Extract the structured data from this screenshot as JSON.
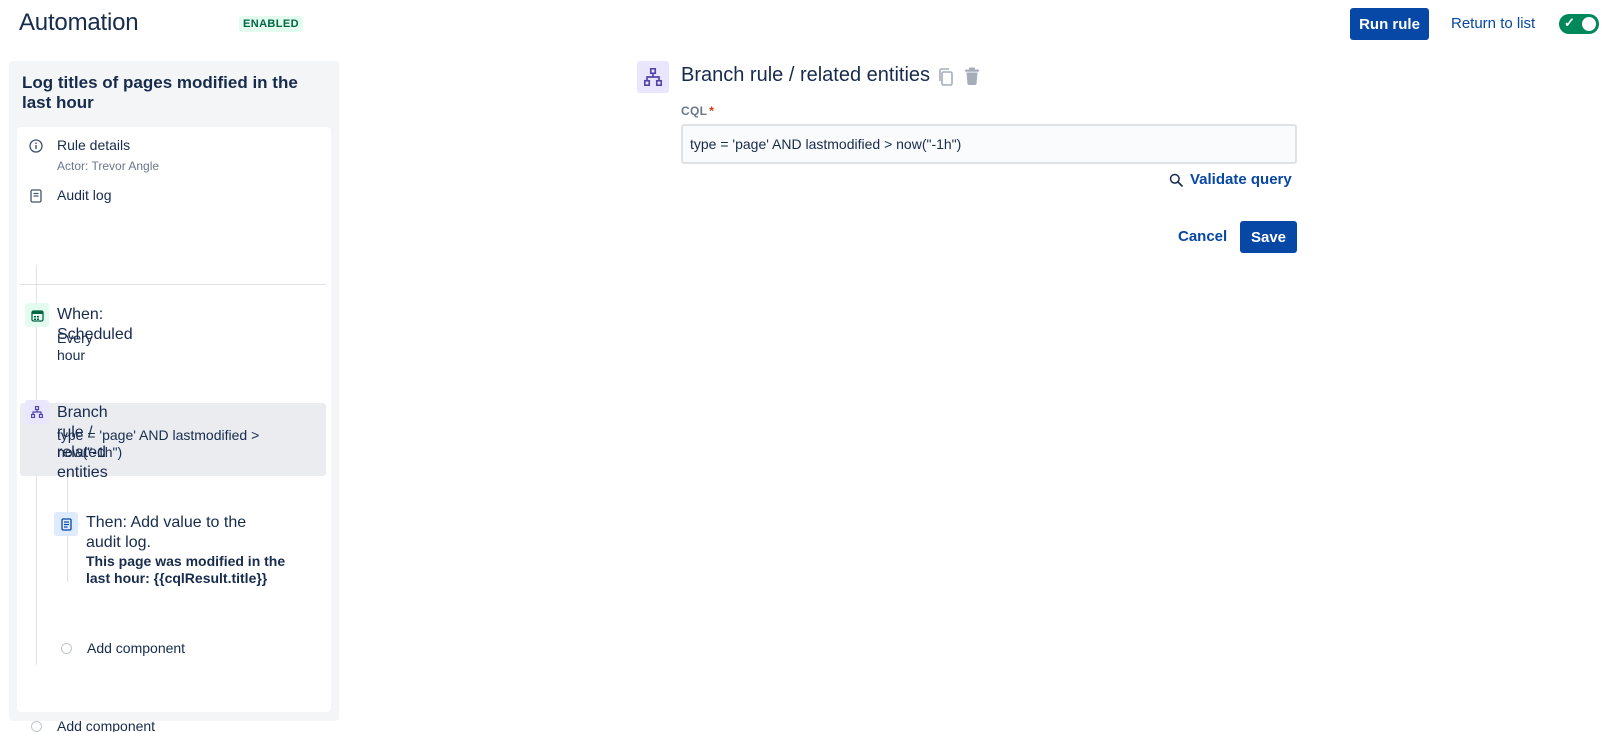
{
  "header": {
    "title": "Automation",
    "status": "ENABLED",
    "run_rule_label": "Run rule",
    "return_label": "Return to list",
    "toggle_on": true
  },
  "sidebar": {
    "rule_name": "Log titles of pages modified in the last hour",
    "rule_details_label": "Rule details",
    "rule_details_sub": "Actor: Trevor Angle",
    "audit_log_label": "Audit log",
    "components": [
      {
        "title": "When: Scheduled",
        "description": "Every hour",
        "icon": "calendar-icon"
      },
      {
        "title": "Branch rule / related entities",
        "description": "type = 'page' AND lastmodified > now(\"-1h\")",
        "icon": "branch-icon"
      },
      {
        "title": "Then: Add value to the audit log.",
        "description": "This page was modified in the last hour: {{cqlResult.title}}",
        "icon": "document-icon"
      }
    ],
    "add_component_inner": "Add component",
    "add_component_outer": "Add component"
  },
  "editor": {
    "title": "Branch rule / related entities",
    "cql_label": "CQL",
    "cql_required_mark": "*",
    "cql_value": "type = 'page' AND lastmodified > now(\"-1h\")",
    "validate_label": "Validate query",
    "cancel_label": "Cancel",
    "save_label": "Save"
  },
  "colors": {
    "primary": "#0747a6",
    "enabled_bg": "#e3fcef",
    "enabled_text": "#006644",
    "toggle_on": "#00875a",
    "required": "#de350b",
    "branch_icon_bg": "#eae6ff",
    "trigger_icon_bg": "#e3fcef",
    "action_icon_bg": "#deebff"
  }
}
